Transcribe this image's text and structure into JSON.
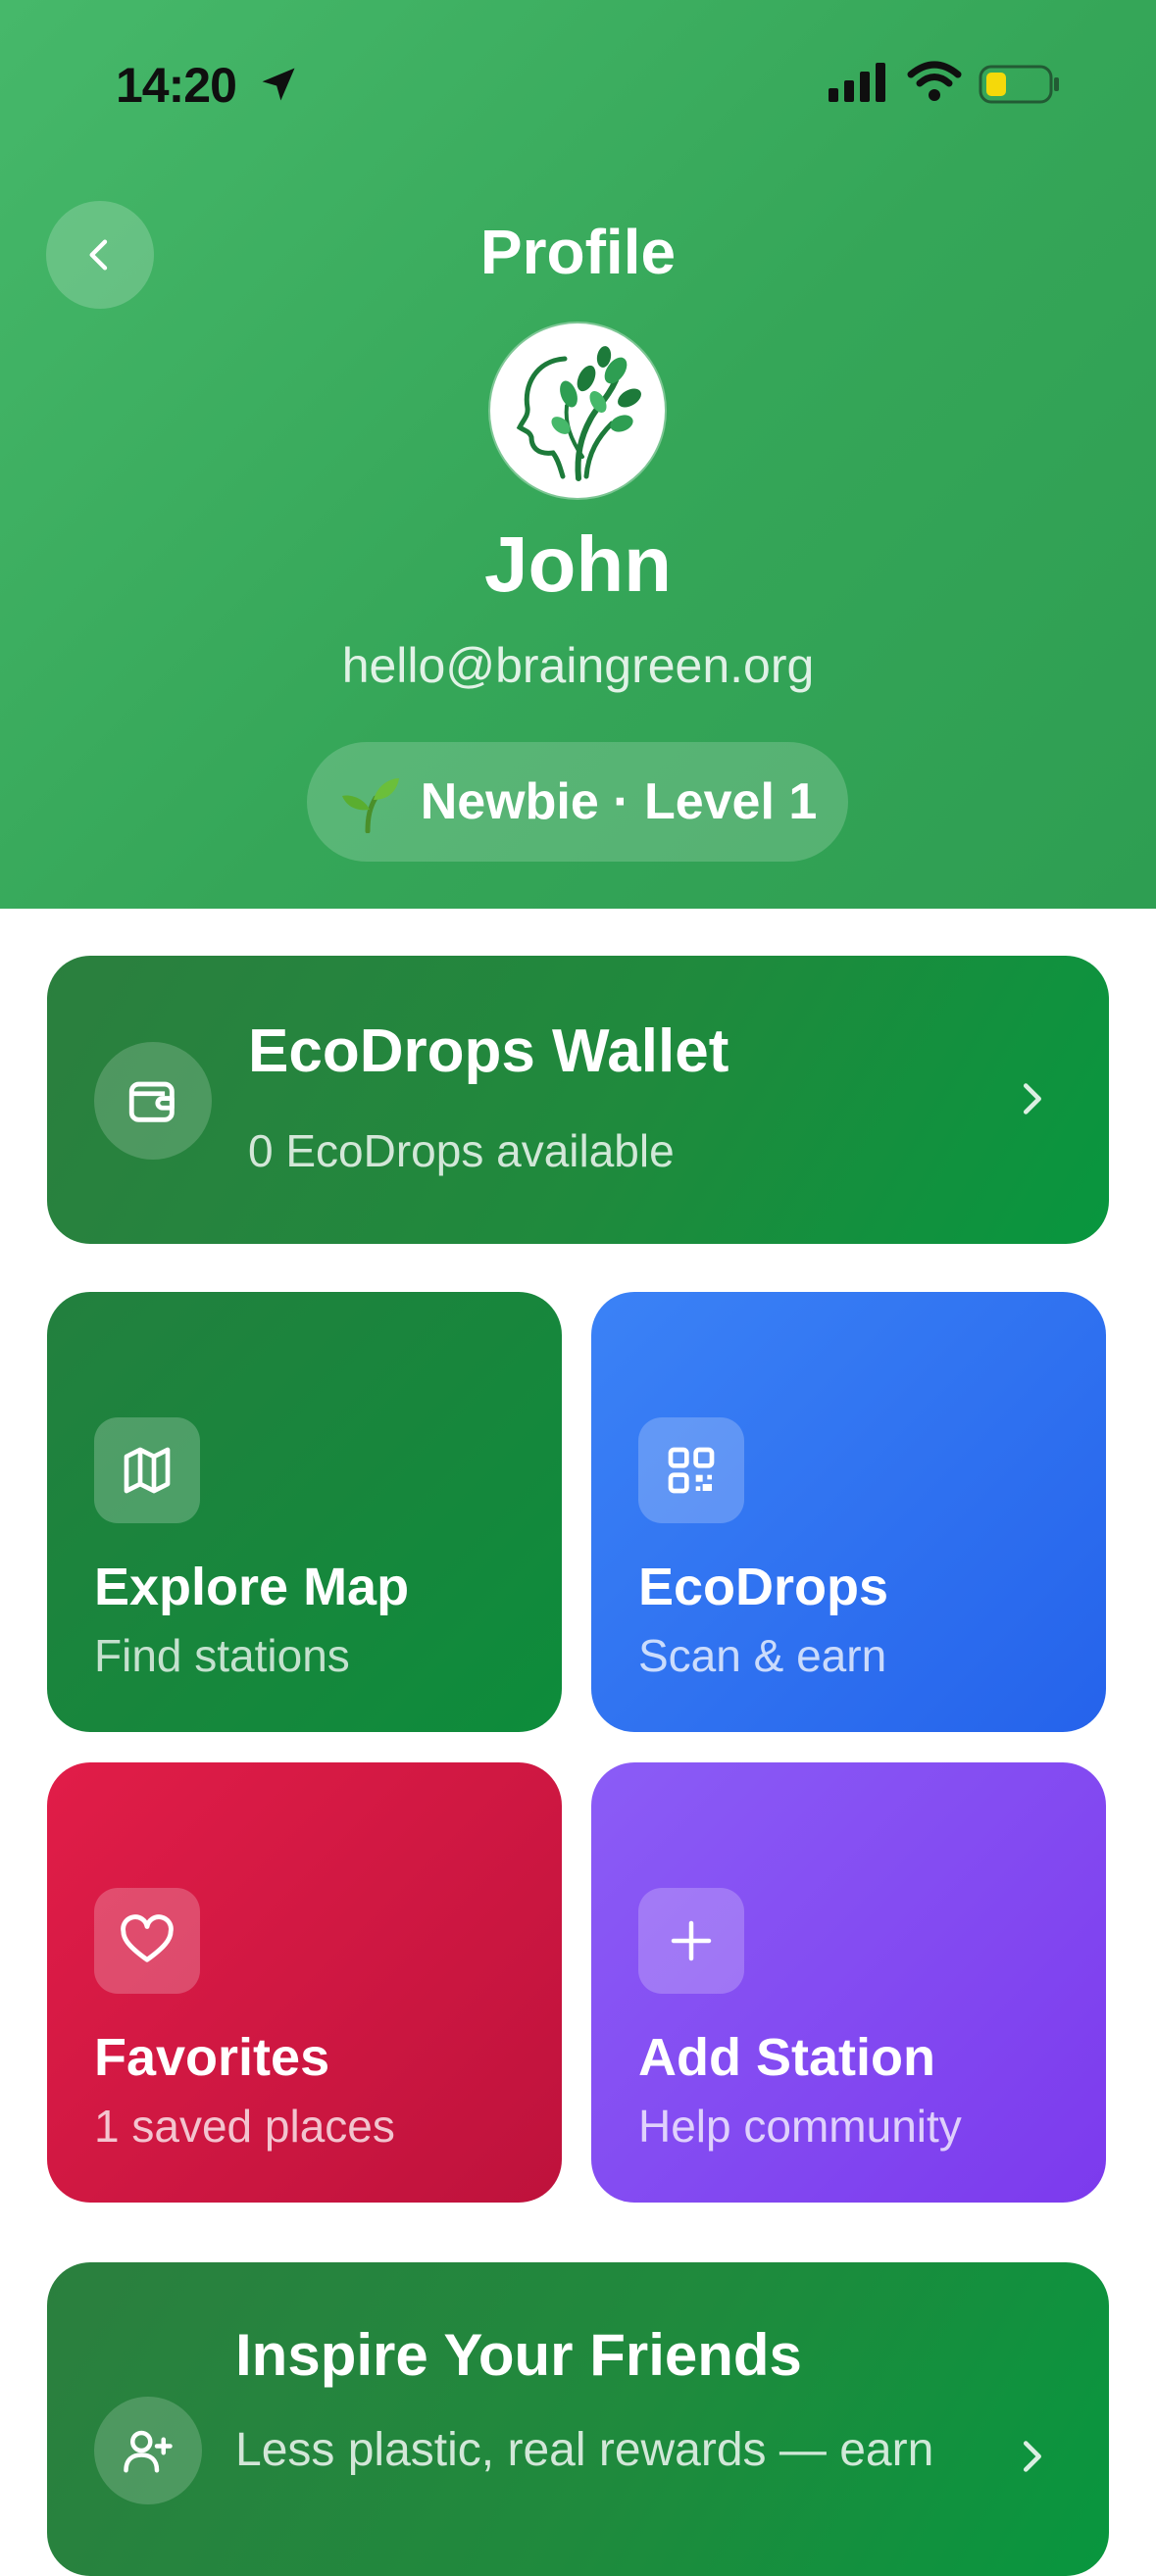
{
  "status_bar": {
    "time": "14:20"
  },
  "header": {
    "title": "Profile",
    "name": "John",
    "email": "hello@braingreen.org",
    "level_badge": "Newbie · Level 1"
  },
  "wallet": {
    "title": "EcoDrops Wallet",
    "subtitle": "0 EcoDrops available"
  },
  "tiles": [
    {
      "title": "Explore Map",
      "subtitle": "Find stations",
      "icon": "map-icon"
    },
    {
      "title": "EcoDrops",
      "subtitle": "Scan & earn",
      "icon": "qr-code-icon"
    },
    {
      "title": "Favorites",
      "subtitle": "1 saved places",
      "icon": "heart-icon"
    },
    {
      "title": "Add Station",
      "subtitle": "Help community",
      "icon": "plus-icon"
    }
  ],
  "invite": {
    "title": "Inspire Your Friends",
    "subtitle": "Less plastic, real rewards — earn"
  },
  "colors": {
    "header_green": "#3fb062",
    "wallet_green": "#1f8a3d",
    "map_green": "#23803e",
    "ecodrops_blue": "#3b82f6",
    "favorites_red": "#e11d48",
    "add_station_purple": "#8b5cf6"
  }
}
